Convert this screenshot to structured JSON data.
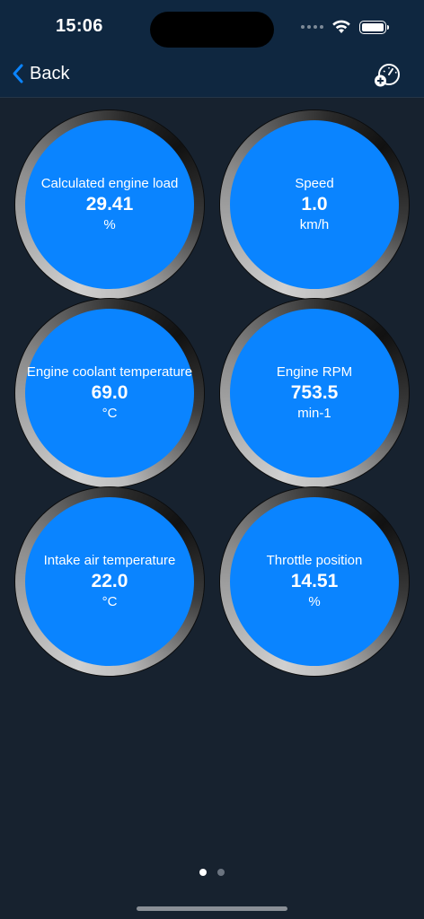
{
  "status_bar": {
    "time": "15:06"
  },
  "nav": {
    "back_label": "Back",
    "add_gauge_icon": "gauge-add-icon"
  },
  "gauges": [
    {
      "label": "Calculated engine load",
      "value": "29.41",
      "unit": "%"
    },
    {
      "label": "Speed",
      "value": "1.0",
      "unit": "km/h"
    },
    {
      "label": "Engine coolant temperature",
      "value": "69.0",
      "unit": "°C"
    },
    {
      "label": "Engine RPM",
      "value": "753.5",
      "unit": "min-1"
    },
    {
      "label": "Intake air temperature",
      "value": "22.0",
      "unit": "°C"
    },
    {
      "label": "Throttle position",
      "value": "14.51",
      "unit": "%"
    }
  ],
  "page_indicator": {
    "pages": 2,
    "current": 1
  },
  "colors": {
    "accent": "#0a84ff",
    "background": "#17222f",
    "nav_background": "#0f2740"
  }
}
